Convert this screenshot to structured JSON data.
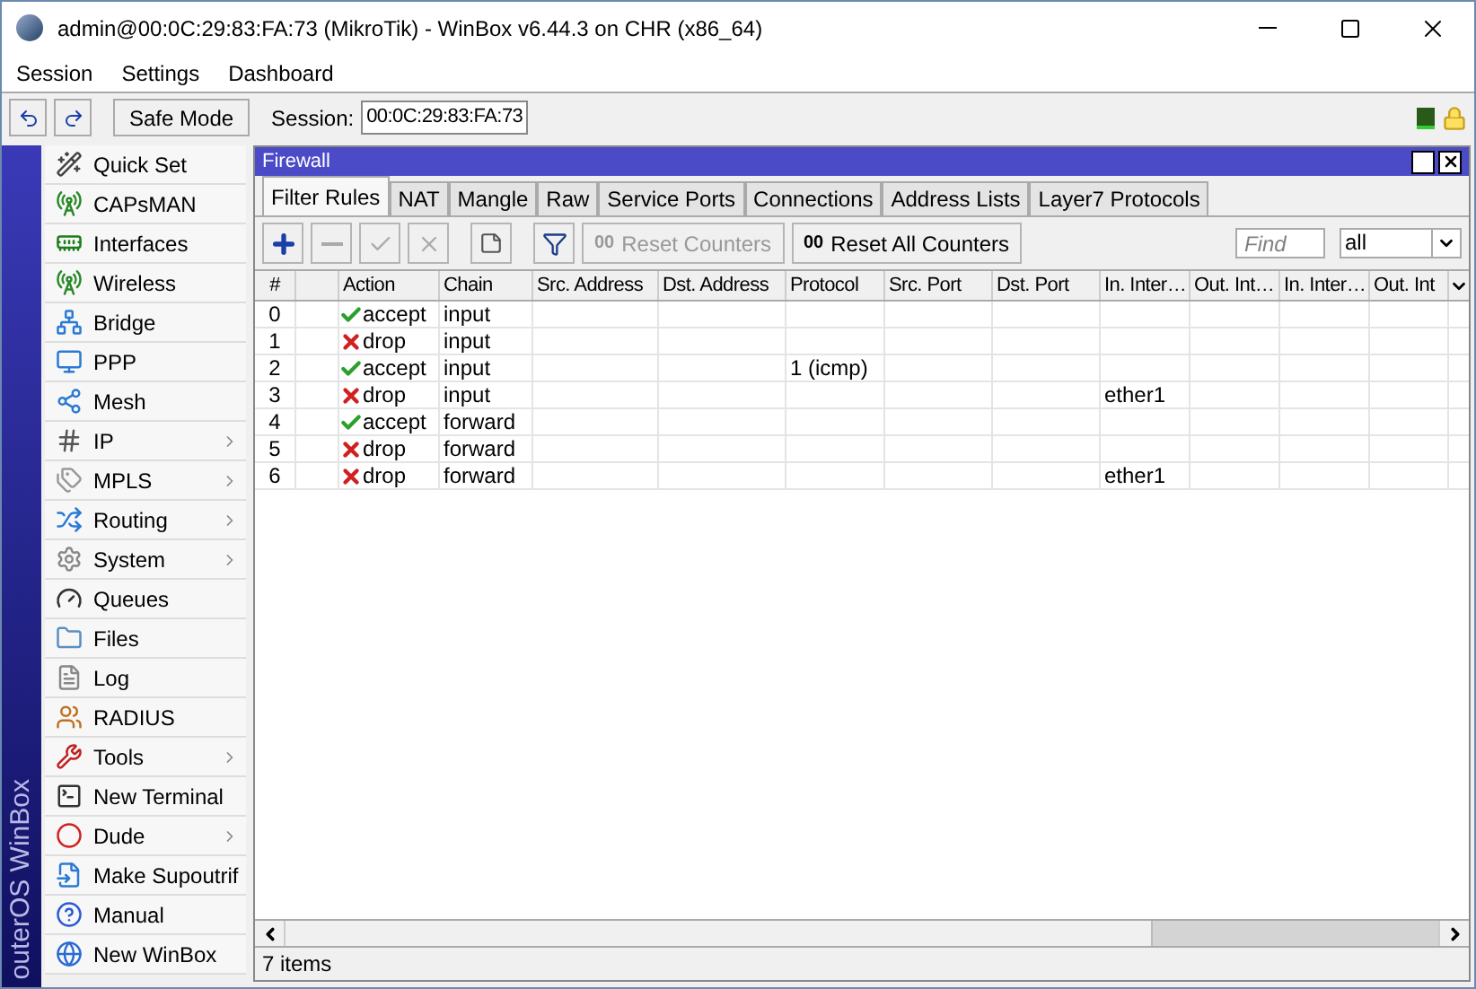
{
  "window": {
    "title": "admin@00:0C:29:83:FA:73 (MikroTik) - WinBox v6.44.3 on CHR (x86_64)"
  },
  "menu": [
    "Session",
    "Settings",
    "Dashboard"
  ],
  "toolbar": {
    "safe_mode": "Safe Mode",
    "session_label": "Session:",
    "session_value": "00:0C:29:83:FA:73"
  },
  "brand": "outerOS WinBox",
  "sidebar": {
    "items": [
      {
        "label": "Quick Set",
        "submenu": false
      },
      {
        "label": "CAPsMAN",
        "submenu": false
      },
      {
        "label": "Interfaces",
        "submenu": false
      },
      {
        "label": "Wireless",
        "submenu": false
      },
      {
        "label": "Bridge",
        "submenu": false
      },
      {
        "label": "PPP",
        "submenu": false
      },
      {
        "label": "Mesh",
        "submenu": false
      },
      {
        "label": "IP",
        "submenu": true
      },
      {
        "label": "MPLS",
        "submenu": true
      },
      {
        "label": "Routing",
        "submenu": true
      },
      {
        "label": "System",
        "submenu": true
      },
      {
        "label": "Queues",
        "submenu": false
      },
      {
        "label": "Files",
        "submenu": false
      },
      {
        "label": "Log",
        "submenu": false
      },
      {
        "label": "RADIUS",
        "submenu": false
      },
      {
        "label": "Tools",
        "submenu": true
      },
      {
        "label": "New Terminal",
        "submenu": false
      },
      {
        "label": "Dude",
        "submenu": true
      },
      {
        "label": "Make Supoutrif",
        "submenu": false
      },
      {
        "label": "Manual",
        "submenu": false
      },
      {
        "label": "New WinBox",
        "submenu": false
      }
    ]
  },
  "firewall": {
    "title": "Firewall",
    "tabs": [
      {
        "label": "Filter Rules",
        "selected": true
      },
      {
        "label": "NAT",
        "selected": false
      },
      {
        "label": "Mangle",
        "selected": false
      },
      {
        "label": "Raw",
        "selected": false
      },
      {
        "label": "Service Ports",
        "selected": false
      },
      {
        "label": "Connections",
        "selected": false
      },
      {
        "label": "Address Lists",
        "selected": false
      },
      {
        "label": "Layer7 Protocols",
        "selected": false
      }
    ],
    "buttons": [
      {
        "kind": "add",
        "disabled": false
      },
      {
        "kind": "remove",
        "disabled": true
      },
      {
        "kind": "enable",
        "disabled": true
      },
      {
        "kind": "disable",
        "disabled": true
      },
      {
        "kind": "comment",
        "disabled": false
      },
      {
        "kind": "filter",
        "disabled": false
      },
      {
        "kind": "text",
        "label": "Reset Counters",
        "disabled": true
      },
      {
        "kind": "text",
        "label": "Reset All Counters",
        "disabled": false
      }
    ],
    "counter_glyph": [
      "00",
      "00"
    ],
    "find": {
      "placeholder": "Find"
    },
    "filter_value": "all",
    "table": {
      "columns": [
        "#",
        "",
        "Action",
        "Chain",
        "Src. Address",
        "Dst. Address",
        "Protocol",
        "Src. Port",
        "Dst. Port",
        "In. Inter…",
        "Out. Int…",
        "In. Inter…",
        "Out. Int"
      ],
      "rows": [
        {
          "number": "0",
          "action": {
            "kind": "accept",
            "label": "accept"
          },
          "chain": "input"
        },
        {
          "number": "1",
          "action": {
            "kind": "drop",
            "label": "drop"
          },
          "chain": "input"
        },
        {
          "number": "2",
          "action": {
            "kind": "accept",
            "label": "accept"
          },
          "chain": "input",
          "protocol": "1 (icmp)"
        },
        {
          "number": "3",
          "action": {
            "kind": "drop",
            "label": "drop"
          },
          "chain": "input",
          "in_interface": "ether1"
        },
        {
          "number": "4",
          "action": {
            "kind": "accept",
            "label": "accept"
          },
          "chain": "forward"
        },
        {
          "number": "5",
          "action": {
            "kind": "drop",
            "label": "drop"
          },
          "chain": "forward"
        },
        {
          "number": "6",
          "action": {
            "kind": "drop",
            "label": "drop"
          },
          "chain": "forward",
          "in_interface": "ether1"
        }
      ]
    },
    "status": "7 items"
  }
}
